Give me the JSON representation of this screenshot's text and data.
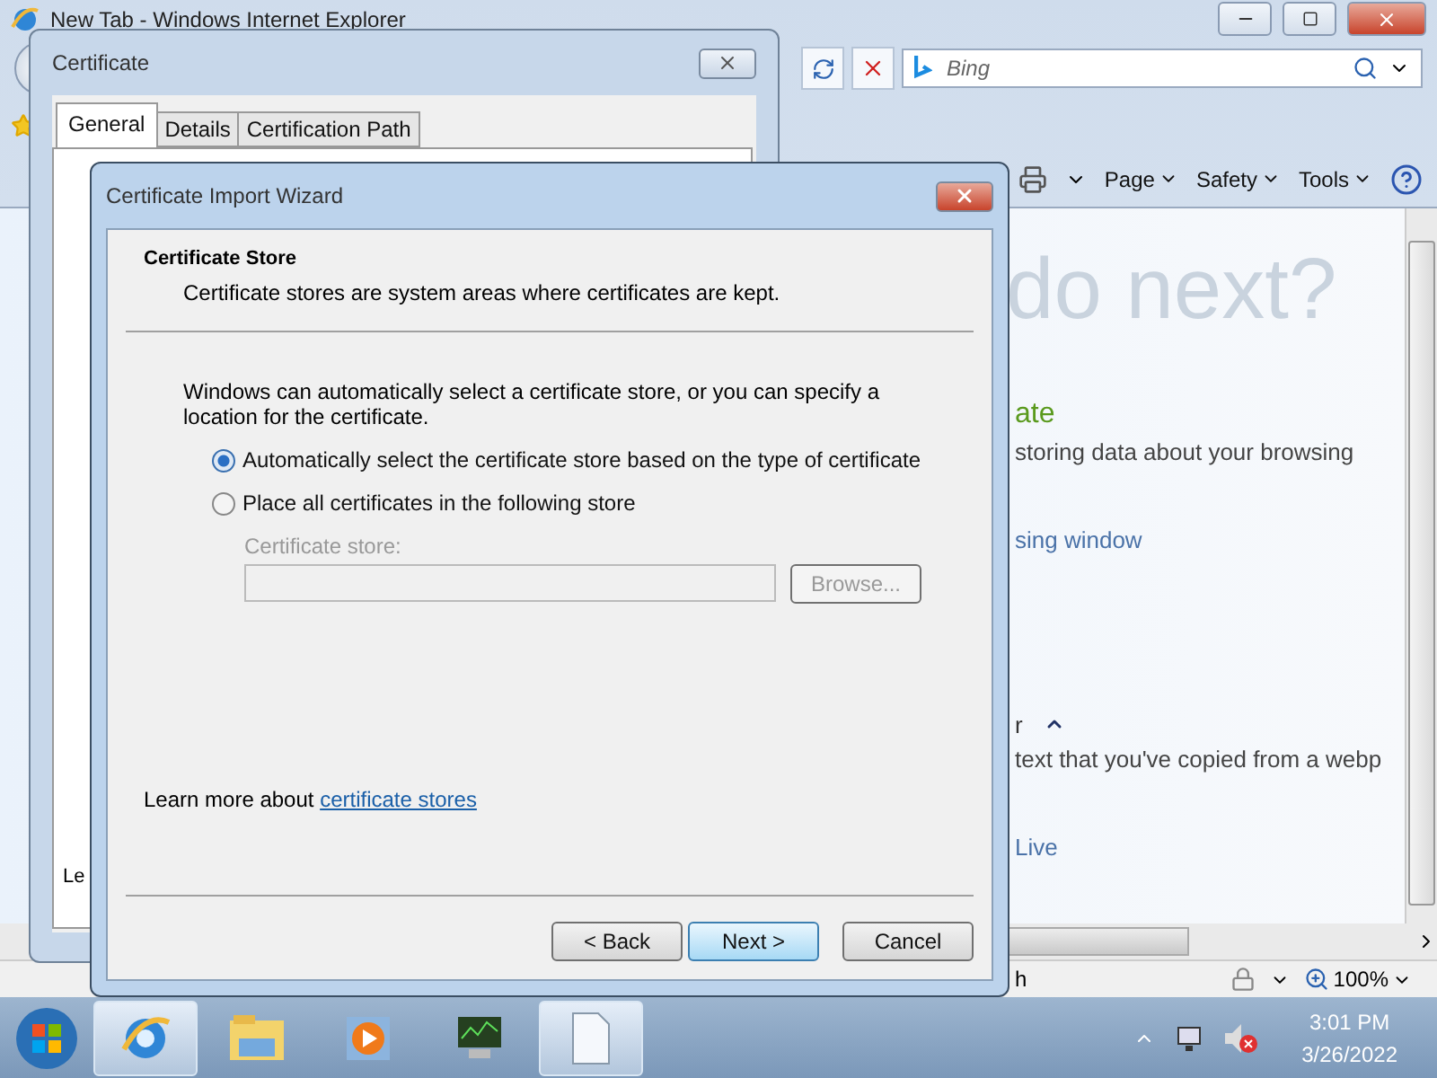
{
  "ie_window": {
    "title": "New Tab - Windows Internet Explorer",
    "search": {
      "placeholder": "Bing"
    },
    "commands": [
      {
        "label": "Page"
      },
      {
        "label": "Safety"
      },
      {
        "label": "Tools"
      }
    ],
    "content": {
      "heading": "do next?",
      "items": [
        {
          "kind": "heading",
          "text": "ate"
        },
        {
          "kind": "text",
          "text": "storing data about your browsing"
        },
        {
          "kind": "link",
          "text": "sing window"
        },
        {
          "kind": "collapse",
          "text": "r"
        },
        {
          "kind": "text",
          "text": "text that you've copied from a webp"
        },
        {
          "kind": "link",
          "text": "Live"
        }
      ]
    },
    "status": {
      "text": "h",
      "zoom": "100%"
    }
  },
  "certificate_dialog": {
    "title": "Certificate",
    "tabs": [
      {
        "label": "General",
        "selected": true
      },
      {
        "label": "Details",
        "selected": false
      },
      {
        "label": "Certification Path",
        "selected": false
      }
    ],
    "text": "Le"
  },
  "wizard": {
    "title": "Certificate Import Wizard",
    "heading": "Certificate Store",
    "subtitle": "Certificate stores are system areas where certificates are kept.",
    "description": "Windows can automatically select a certificate store, or you can specify a location for the certificate.",
    "options": [
      {
        "label": "Automatically select the certificate store based on the type of certificate",
        "selected": true
      },
      {
        "label": "Place all certificates in the following store",
        "selected": false
      }
    ],
    "store_label": "Certificate store:",
    "store_field": {
      "disabled": true
    },
    "browse": {
      "label": "Browse...",
      "disabled": true
    },
    "learn_more": {
      "text": "Learn more about",
      "link": "certificate stores"
    },
    "buttons": [
      {
        "label": "< Back",
        "hovered": false
      },
      {
        "label": "Next >",
        "hovered": true
      },
      {
        "label": "Cancel",
        "hovered": false
      }
    ]
  },
  "taskbar": {
    "apps": [
      {
        "kind": "browser",
        "active": true
      },
      {
        "kind": "folder",
        "active": false
      },
      {
        "kind": "media",
        "active": false
      },
      {
        "kind": "monitor",
        "active": false
      },
      {
        "kind": "document",
        "active": true
      }
    ],
    "clock": {
      "time": "3:01 PM",
      "date": "3/26/2022"
    }
  }
}
